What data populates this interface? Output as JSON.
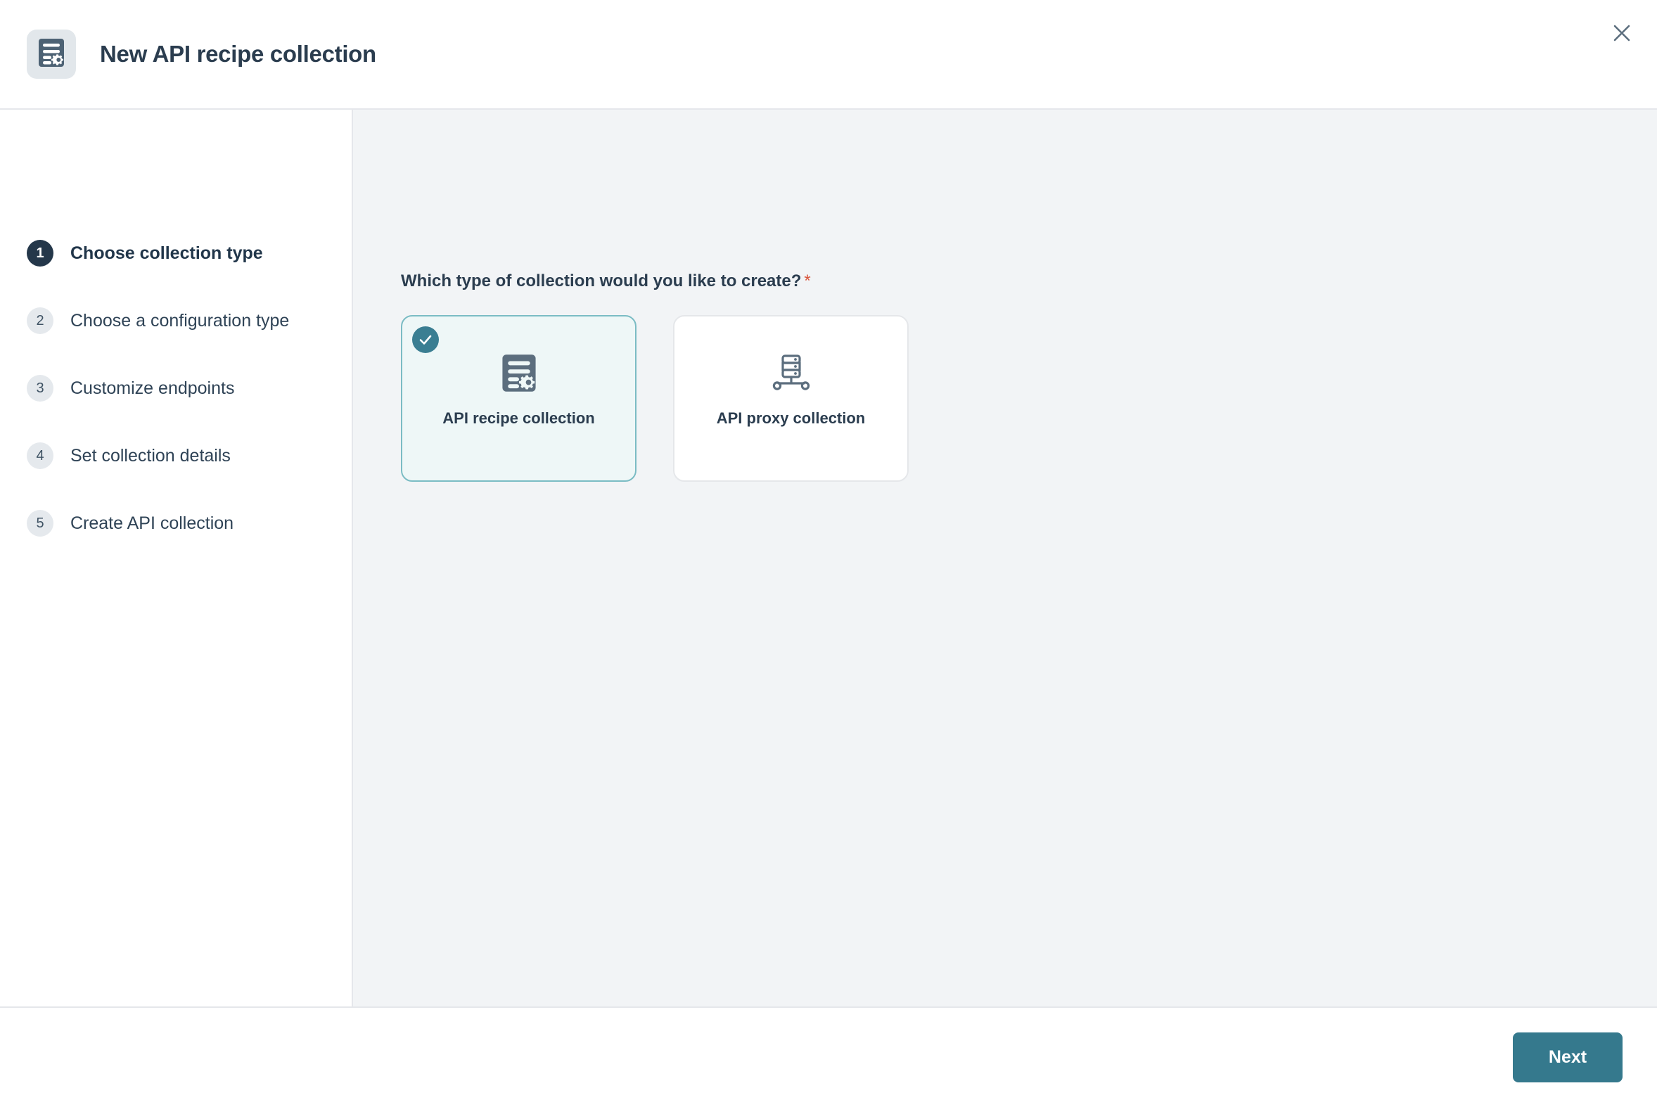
{
  "header": {
    "title": "New API recipe collection",
    "icon": "document-gear-icon",
    "close_icon": "close-icon",
    "icon_tile_color": "#e2e7eb"
  },
  "sidebar": {
    "steps": [
      {
        "number": "1",
        "label": "Choose collection type",
        "active": true
      },
      {
        "number": "2",
        "label": "Choose a configuration type",
        "active": false
      },
      {
        "number": "3",
        "label": "Customize endpoints",
        "active": false
      },
      {
        "number": "4",
        "label": "Set collection details",
        "active": false
      },
      {
        "number": "5",
        "label": "Create API collection",
        "active": false
      }
    ]
  },
  "main": {
    "question": "Which type of collection would you like to create?",
    "required_marker": "*",
    "cards": [
      {
        "label": "API recipe collection",
        "icon": "document-gear-icon",
        "selected": true,
        "check_icon": "check-circle-icon"
      },
      {
        "label": "API proxy collection",
        "icon": "server-network-icon",
        "selected": false
      }
    ]
  },
  "footer": {
    "next_label": "Next"
  },
  "colors": {
    "accent": "#35798d",
    "selected_border": "#7bbcc4",
    "selected_bg": "#eef7f7",
    "text_dark": "#2b3d4f",
    "icon_gray": "#5c6e7e",
    "required_star": "#d9563d",
    "main_bg": "#f2f4f6",
    "step_active_badge": "#24374a"
  }
}
